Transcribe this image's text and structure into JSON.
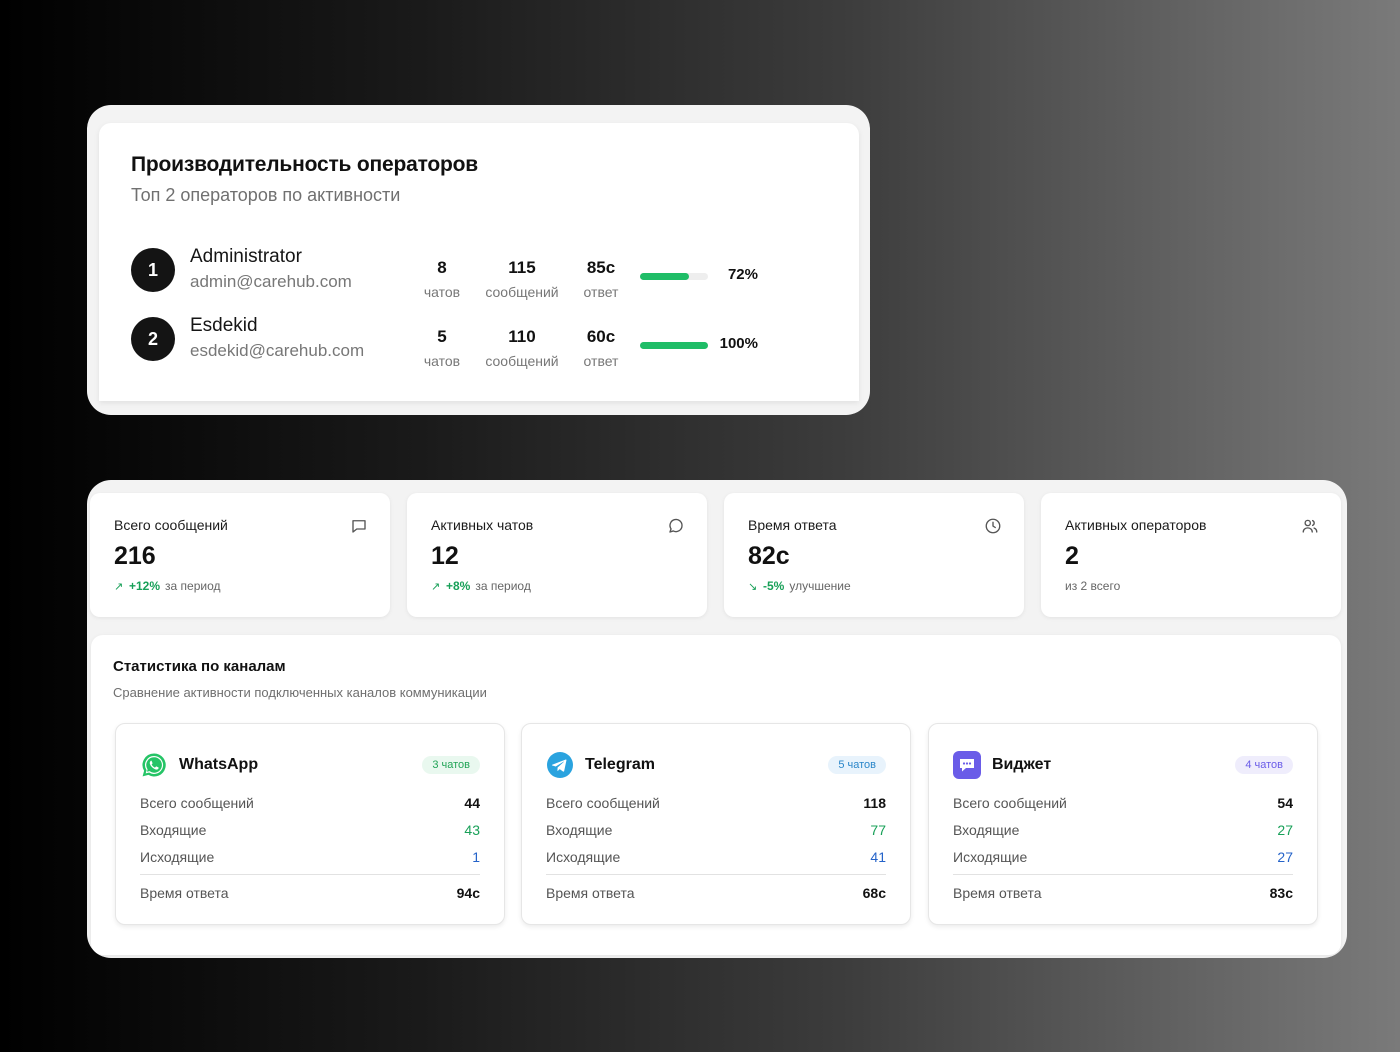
{
  "operators": {
    "title": "Производительность операторов",
    "subtitle": "Топ 2 операторов по активности",
    "rows": [
      {
        "rank": "1",
        "name": "Administrator",
        "email": "admin@carehub.com",
        "chats": "8",
        "chats_label": "чатов",
        "messages": "115",
        "messages_label": "сообщений",
        "response": "85с",
        "response_label": "ответ",
        "progress": 0.72,
        "progress_label": "72%"
      },
      {
        "rank": "2",
        "name": "Esdekid",
        "email": "esdekid@carehub.com",
        "chats": "5",
        "chats_label": "чатов",
        "messages": "110",
        "messages_label": "сообщений",
        "response": "60с",
        "response_label": "ответ",
        "progress": 1.0,
        "progress_label": "100%"
      }
    ]
  },
  "kpis": [
    {
      "title": "Всего сообщений",
      "value": "216",
      "arrow": "↗",
      "delta": "+12%",
      "note": "за период",
      "icon": "message-square-icon"
    },
    {
      "title": "Активных чатов",
      "value": "12",
      "arrow": "↗",
      "delta": "+8%",
      "note": "за период",
      "icon": "message-circle-icon"
    },
    {
      "title": "Время ответа",
      "value": "82с",
      "arrow": "↘",
      "delta": "-5%",
      "note": "улучшение",
      "icon": "clock-icon"
    },
    {
      "title": "Активных операторов",
      "value": "2",
      "arrow": "",
      "delta": "",
      "note": "из 2 всего",
      "icon": "users-icon"
    }
  ],
  "channels": {
    "title": "Статистика по каналам",
    "subtitle": "Сравнение активности подключенных каналов коммуникации",
    "cards": [
      {
        "name": "WhatsApp",
        "badge": "3 чатов",
        "icon": "whatsapp-icon",
        "total_label": "Всего сообщений",
        "total": "44",
        "in_label": "Входящие",
        "in": "43",
        "out_label": "Исходящие",
        "out": "1",
        "resp_label": "Время ответа",
        "resp": "94с"
      },
      {
        "name": "Telegram",
        "badge": "5 чатов",
        "icon": "telegram-icon",
        "total_label": "Всего сообщений",
        "total": "118",
        "in_label": "Входящие",
        "in": "77",
        "out_label": "Исходящие",
        "out": "41",
        "resp_label": "Время ответа",
        "resp": "68с"
      },
      {
        "name": "Виджет",
        "badge": "4 чатов",
        "icon": "widget-icon",
        "total_label": "Всего сообщений",
        "total": "54",
        "in_label": "Входящие",
        "in": "27",
        "out_label": "Исходящие",
        "out": "27",
        "resp_label": "Время ответа",
        "resp": "83с"
      }
    ]
  },
  "colors": {
    "accent_green": "#1fbd67",
    "positive": "#18a058",
    "outgoing_blue": "#2563c9",
    "telegram": "#2aa3df",
    "widget": "#6a5ce8",
    "whatsapp": "#25c466"
  }
}
